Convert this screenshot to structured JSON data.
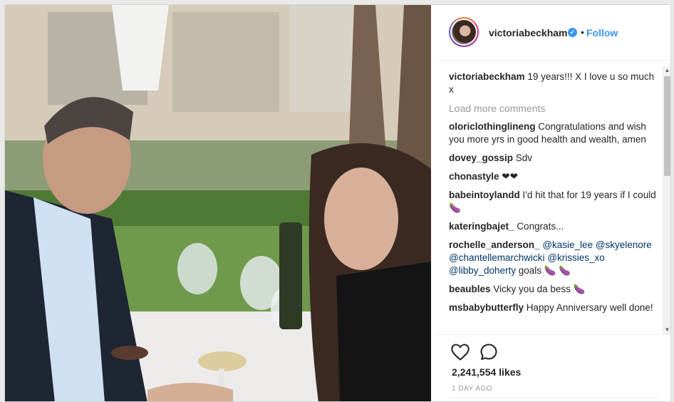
{
  "post": {
    "username": "victoriabeckham",
    "follow_label": "Follow",
    "dot": "•",
    "caption_user": "victoriabeckham",
    "caption_text": "19 years!!! X I love u so much x",
    "load_more": "Load more comments",
    "comments": [
      {
        "user": "oloriclothinglineng",
        "text": "Congratulations and wish you more yrs in good health and wealth, amen"
      },
      {
        "user": "dovey_gossip",
        "text": "Sdv"
      },
      {
        "user": "chonastyle",
        "text": "❤❤"
      },
      {
        "user": "babeintoylandd",
        "text": "I'd hit that for 19 years if I could 🍆"
      },
      {
        "user": "kateringbajet_",
        "text": "Congrats..."
      },
      {
        "user": "rochelle_anderson_",
        "mentions": "@kasie_lee @skyelenore @chantellemarchwicki @krissies_xo @libby_doherty",
        "text": "goals 🍆 🍆"
      },
      {
        "user": "beaubles",
        "text": "Vicky you da bess 🍆"
      },
      {
        "user": "msbabybutterfly",
        "text": "Happy Anniversary well done!"
      }
    ],
    "likes": "2,241,554 likes",
    "date": "1 DAY AGO"
  },
  "icons": {
    "heart": "heart-icon",
    "comment": "comment-icon",
    "verified": "verified-badge-icon"
  },
  "colors": {
    "link": "#3897f0",
    "text": "#262626",
    "muted": "#999999"
  }
}
